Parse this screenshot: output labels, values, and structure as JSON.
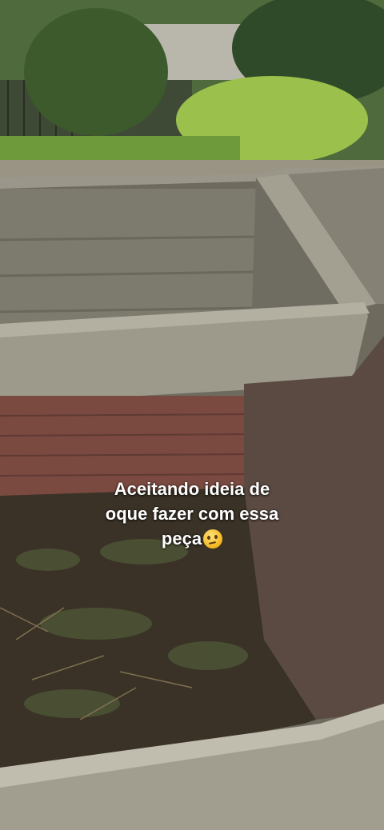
{
  "caption": {
    "line1": "Aceitando ideia de",
    "line2": "oque fazer com essa",
    "line3": "peça"
  },
  "colors": {
    "sky_foliage": "#5f7a48",
    "concrete": "#8c8a7e",
    "brick": "#7a4a40",
    "soil": "#3a3226"
  },
  "icons": {
    "caption_emoji": "thinking-face-icon"
  }
}
